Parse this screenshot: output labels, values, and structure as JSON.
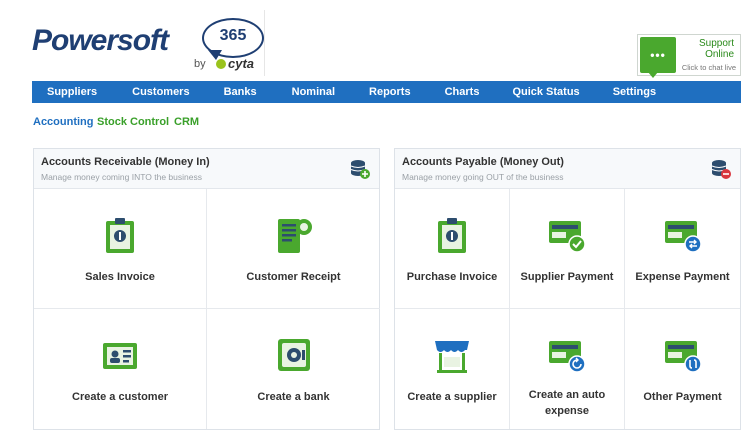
{
  "brand": {
    "name": "Powersoft",
    "badge": "365",
    "by": "by",
    "partner": "cyta"
  },
  "support": {
    "line1": "Support",
    "line2": "Online",
    "line3": "Click to chat live",
    "icon": "chat-icon",
    "color": "#4aa82e"
  },
  "nav": {
    "color": "#1f6fc0",
    "items": [
      "Suppliers",
      "Customers",
      "Banks",
      "Nominal",
      "Reports",
      "Charts",
      "Quick Status",
      "Settings"
    ]
  },
  "subtabs": [
    {
      "label": "Accounting",
      "color": "#1f6fc0"
    },
    {
      "label": "Stock Control",
      "color": "#3aa02a"
    },
    {
      "label": "CRM",
      "color": "#3aa02a"
    }
  ],
  "receivable": {
    "title": "Accounts Receivable (Money In)",
    "subtitle": "Manage money coming INTO the business",
    "icon": "coins-plus-icon",
    "tiles": [
      {
        "label": "Sales Invoice",
        "icon": "invoice-clipboard-icon"
      },
      {
        "label": "Customer Receipt",
        "icon": "receipt-icon"
      },
      {
        "label": "Create a customer",
        "icon": "customer-card-icon"
      },
      {
        "label": "Create a bank",
        "icon": "safe-icon"
      }
    ]
  },
  "payable": {
    "title": "Accounts Payable (Money Out)",
    "subtitle": "Manage money going OUT of the business",
    "icon": "coins-minus-icon",
    "tiles": [
      {
        "label": "Purchase Invoice",
        "icon": "invoice-clipboard-icon"
      },
      {
        "label": "Supplier Payment",
        "icon": "card-check-icon"
      },
      {
        "label": "Expense Payment",
        "icon": "card-exchange-icon"
      },
      {
        "label": "Create a supplier",
        "icon": "storefront-icon"
      },
      {
        "label": "Create an auto expense",
        "icon": "card-refresh-icon"
      },
      {
        "label": "Other Payment",
        "icon": "card-transfer-icon"
      }
    ]
  },
  "colors": {
    "icon_green": "#4aa82e",
    "icon_dark": "#2d4d6e",
    "accent_blue": "#1f6fc0"
  }
}
